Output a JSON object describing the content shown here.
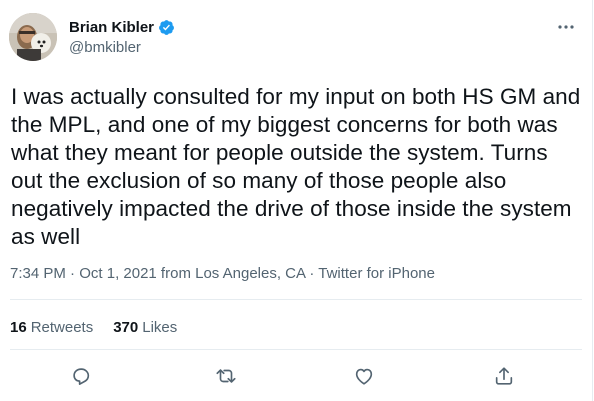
{
  "tweet": {
    "author_name": "Brian Kibler",
    "author_handle": "@bmkibler",
    "text": "I was actually consulted for my input on both HS GM and the MPL, and one of my biggest concerns for both was what they meant for people outside the system. Turns out the exclusion of so many of those people also negatively impacted the drive of those inside the system as well",
    "time": "7:34 PM",
    "separator": "·",
    "date": "Oct 1, 2021 from Los Angeles, CA",
    "client": "Twitter for iPhone"
  },
  "stats": {
    "retweets_count": "16",
    "retweets_label": "Retweets",
    "likes_count": "370",
    "likes_label": "Likes"
  },
  "icons": {
    "verified": "verified-badge-icon",
    "more": "more-icon",
    "reply": "reply-icon",
    "retweet": "retweet-icon",
    "like": "like-icon",
    "share": "share-icon"
  },
  "colors": {
    "verified_blue": "#1d9bf0",
    "secondary_text": "#536471",
    "primary_text": "#0f1419",
    "divider": "#e6ecf0"
  }
}
